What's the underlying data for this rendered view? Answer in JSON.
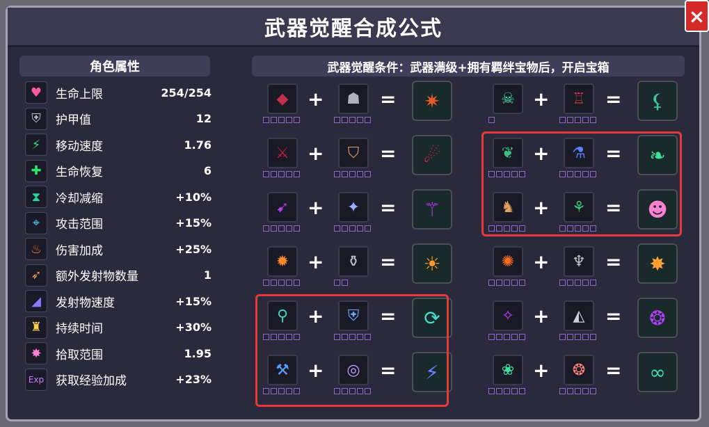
{
  "title": "武器觉醒合成公式",
  "close_label": "×",
  "left_header": "角色属性",
  "right_header": "武器觉醒条件：武器满级+拥有羁绊宝物后，开启宝箱",
  "stats": [
    {
      "icon": "heart-icon",
      "glyph": "♥",
      "color": "#ff5aa0",
      "label": "生命上限",
      "value": "254/254"
    },
    {
      "icon": "armor-icon",
      "glyph": "⛨",
      "color": "#b9c2d6",
      "label": "护甲值",
      "value": "12"
    },
    {
      "icon": "boot-icon",
      "glyph": "⚡",
      "color": "#2fe07a",
      "label": "移动速度",
      "value": "1.76"
    },
    {
      "icon": "cross-icon",
      "glyph": "✚",
      "color": "#2ee66b",
      "label": "生命恢复",
      "value": "6"
    },
    {
      "icon": "hourglass-icon",
      "glyph": "⧗",
      "color": "#24d8a0",
      "label": "冷却减缩",
      "value": "+10%"
    },
    {
      "icon": "target-icon",
      "glyph": "⌖",
      "color": "#4fc7ff",
      "label": "攻击范围",
      "value": "+15%"
    },
    {
      "icon": "flame-icon",
      "glyph": "♨",
      "color": "#ff6a2a",
      "label": "伤害加成",
      "value": "+25%"
    },
    {
      "icon": "arrow-icon",
      "glyph": "➶",
      "color": "#e6a25a",
      "label": "额外发射物数量",
      "value": "1"
    },
    {
      "icon": "speed-icon",
      "glyph": "◢",
      "color": "#8b7aff",
      "label": "发射物速度",
      "value": "+15%"
    },
    {
      "icon": "torch-icon",
      "glyph": "♜",
      "color": "#ffd24a",
      "label": "持续时间",
      "value": "+30%"
    },
    {
      "icon": "magnet-icon",
      "glyph": "✸",
      "color": "#ff7fd0",
      "label": "拾取范围",
      "value": "1.95"
    },
    {
      "icon": "exp-icon",
      "glyph": "Exp",
      "color": "#d07bff",
      "label": "获取经验加成",
      "value": "+23%"
    }
  ],
  "recipes_left": [
    {
      "weapon": "crystal-icon",
      "weapon_glyph": "◆",
      "weapon_color": "#c0304a",
      "item": "helmet-icon",
      "item_glyph": "☗",
      "item_color": "#b0b0b8",
      "result": "crest-icon",
      "result_glyph": "✷",
      "result_color": "#e05a2a",
      "weapon_pips": 5,
      "item_pips": 5
    },
    {
      "weapon": "blade-icon",
      "weapon_glyph": "⚔",
      "weapon_color": "#c02040",
      "item": "visor-icon",
      "item_glyph": "⛉",
      "item_color": "#d0a060",
      "result": "scythe-icon",
      "result_glyph": "☄",
      "result_color": "#e02050",
      "weapon_pips": 5,
      "item_pips": 5
    },
    {
      "weapon": "spear-icon",
      "weapon_glyph": "➹",
      "weapon_color": "#b040e0",
      "item": "amulet-icon",
      "item_glyph": "✦",
      "item_color": "#9ab0ff",
      "result": "trident-icon",
      "result_glyph": "⚚",
      "result_color": "#c040ff",
      "weapon_pips": 5,
      "item_pips": 5
    },
    {
      "weapon": "torch-weapon-icon",
      "weapon_glyph": "✹",
      "weapon_color": "#ff8a2a",
      "item": "lantern-icon",
      "item_glyph": "⚱",
      "item_color": "#c0c0c8",
      "result": "fire-icon",
      "result_glyph": "☀",
      "result_color": "#ff9a2a",
      "weapon_pips": 5,
      "item_pips": 2
    },
    {
      "weapon": "lamp-icon",
      "weapon_glyph": "⚲",
      "weapon_color": "#40d0c0",
      "item": "armor-item-icon",
      "item_glyph": "⛨",
      "item_color": "#70a8ff",
      "result": "vortex-icon",
      "result_glyph": "⟳",
      "result_color": "#40e0d0",
      "weapon_pips": 5,
      "item_pips": 5
    },
    {
      "weapon": "hammer-icon",
      "weapon_glyph": "⚒",
      "weapon_color": "#5aa0ff",
      "item": "ring-icon",
      "item_glyph": "◎",
      "item_color": "#c0a0ff",
      "result": "blade-storm-icon",
      "result_glyph": "⚡",
      "result_color": "#6a80ff",
      "weapon_pips": 5,
      "item_pips": 5
    }
  ],
  "recipes_right": [
    {
      "weapon": "jaw-icon",
      "weapon_glyph": "☠",
      "weapon_color": "#40e0b0",
      "item": "cloak-icon",
      "item_glyph": "♖",
      "item_color": "#c04040",
      "result": "claw-icon",
      "result_glyph": "⚸",
      "result_color": "#40c0a0",
      "weapon_pips": 1,
      "item_pips": 5
    },
    {
      "weapon": "leaf-icon",
      "weapon_glyph": "❦",
      "weapon_color": "#40c080",
      "item": "bottle-icon",
      "item_glyph": "⚗",
      "item_color": "#5a80ff",
      "result": "vine-icon",
      "result_glyph": "❧",
      "result_color": "#40e0a0",
      "weapon_pips": 5,
      "item_pips": 5
    },
    {
      "weapon": "totem-icon",
      "weapon_glyph": "♞",
      "weapon_color": "#e0a060",
      "item": "potion-icon",
      "item_glyph": "⚘",
      "item_color": "#30d070",
      "result": "golem-icon",
      "result_glyph": "☻",
      "result_color": "#ff80d0",
      "weapon_pips": 5,
      "item_pips": 5
    },
    {
      "weapon": "fire-staff-icon",
      "weapon_glyph": "✺",
      "weapon_color": "#ff7020",
      "item": "dragon-icon",
      "item_glyph": "♆",
      "item_color": "#c0c0c8",
      "result": "inferno-icon",
      "result_glyph": "✸",
      "result_color": "#ffa030",
      "weapon_pips": 5,
      "item_pips": 5
    },
    {
      "weapon": "wings-icon",
      "weapon_glyph": "✧",
      "weapon_color": "#c040ff",
      "item": "shard-icon",
      "item_glyph": "◭",
      "item_color": "#d0d0d8",
      "result": "bat-icon",
      "result_glyph": "❂",
      "result_color": "#b040ff",
      "weapon_pips": 5,
      "item_pips": 5
    },
    {
      "weapon": "scroll-icon",
      "weapon_glyph": "❀",
      "weapon_color": "#40e0a0",
      "item": "orb-icon",
      "item_glyph": "❂",
      "item_color": "#ff8080",
      "result": "serpent-icon",
      "result_glyph": "∞",
      "result_color": "#40e0b0",
      "weapon_pips": 5,
      "item_pips": 5
    }
  ],
  "plus": "+",
  "equals": "="
}
